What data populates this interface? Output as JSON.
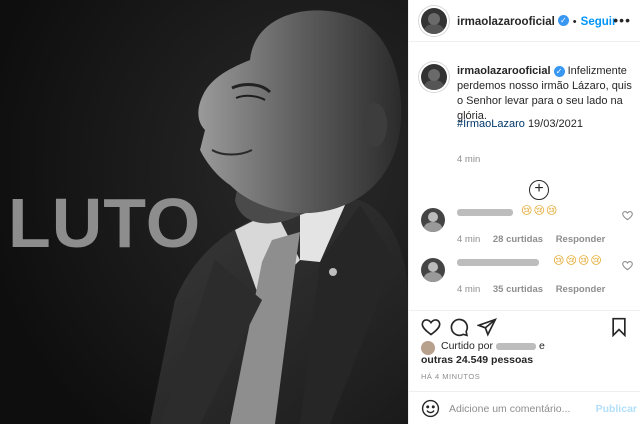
{
  "post": {
    "image_text": "LUTO",
    "author": "irmaolazarooficial",
    "follow_label": "Seguir",
    "more_label": "•••",
    "caption": "Infelizmente perdemos nosso irmão Lázaro, quis o Senhor levar para o seu lado na glória.",
    "hashtag": "#IrmaoLazaro",
    "date": "19/03/2021",
    "caption_time": "4 min"
  },
  "comments": [
    {
      "emojis": "😢😢😢",
      "time": "4 min",
      "likes": "28 curtidas",
      "reply": "Responder"
    },
    {
      "emojis": "😢😢😢😢",
      "time": "4 min",
      "likes": "35 curtidas",
      "reply": "Responder"
    }
  ],
  "likes": {
    "prefix": "Curtido por",
    "and": "e",
    "others": "outras 24.549 pessoas"
  },
  "timestamp": "HÁ 4 MINUTOS",
  "add_comment": {
    "placeholder": "Adicione um comentário...",
    "publish": "Publicar"
  },
  "colors": {
    "accent": "#0095f6",
    "hashtag": "#00376b",
    "muted": "#8e8e8e",
    "publish_disabled": "#b2dffc"
  }
}
